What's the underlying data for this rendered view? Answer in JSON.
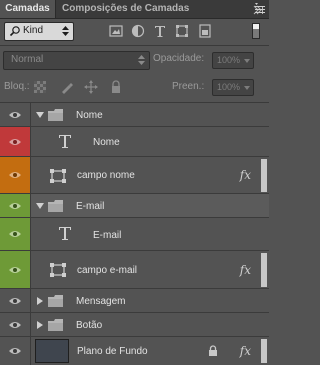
{
  "tabs": [
    {
      "label": "Camadas"
    },
    {
      "label": "Composições de Camadas"
    }
  ],
  "filter": {
    "kind_label": "Kind",
    "icons": [
      "image-icon",
      "adjustment-icon",
      "type-icon",
      "shape-icon",
      "smart-object-icon"
    ]
  },
  "blend": {
    "mode": "Normal",
    "opacity_label": "Opacidade:",
    "opacity_value": "100%"
  },
  "lock": {
    "label": "Bloq.:",
    "fill_label": "Preen.:",
    "fill_value": "100%"
  },
  "layers": [
    {
      "name": "Nome",
      "type": "group",
      "expanded": true,
      "eye_color": "#535353"
    },
    {
      "name": "Nome",
      "type": "text",
      "eye_color": "#c0393a"
    },
    {
      "name": "campo nome",
      "type": "shape",
      "fx": "fx",
      "eye_color": "#c36d10"
    },
    {
      "name": "E-mail",
      "type": "group",
      "expanded": true,
      "eye_color": "#6e9a37"
    },
    {
      "name": "E-mail",
      "type": "text",
      "eye_color": "#6e9a37"
    },
    {
      "name": "campo e-mail",
      "type": "shape",
      "fx": "fx",
      "eye_color": "#6e9a37"
    },
    {
      "name": "Mensagem",
      "type": "group",
      "expanded": false,
      "eye_color": "#535353"
    },
    {
      "name": "Botão",
      "type": "group",
      "expanded": false,
      "eye_color": "#535353"
    },
    {
      "name": "Plano de Fundo",
      "type": "background",
      "fx": "fx",
      "eye_color": "#535353"
    }
  ]
}
